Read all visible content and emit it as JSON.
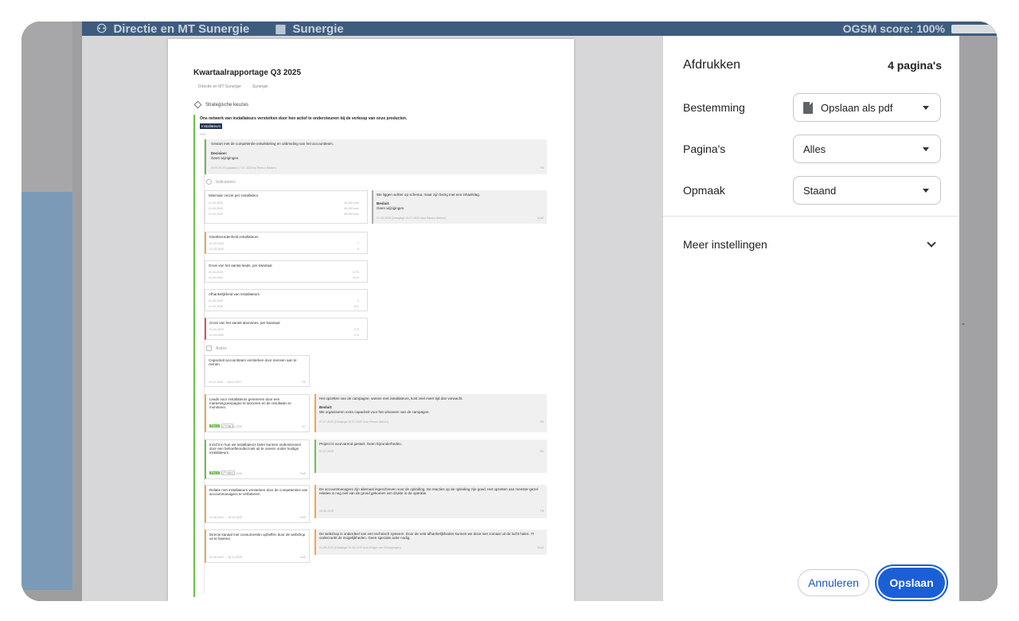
{
  "app": {
    "breadcrumb_team": "Directie en MT Sunergie",
    "breadcrumb_org": "Sunergie",
    "score": "OGSM score: 100%"
  },
  "print_panel": {
    "title": "Afdrukken",
    "page_count": "4 pagina's",
    "destination_label": "Bestemming",
    "destination_value": "Opslaan als pdf",
    "pages_label": "Pagina's",
    "pages_value": "Alles",
    "layout_label": "Opmaak",
    "layout_value": "Staand",
    "more_settings": "Meer instellingen",
    "cancel": "Annuleren",
    "save": "Opslaan"
  },
  "report": {
    "title": "Kwartaalrapportage Q3 2025",
    "crumb_team": "Directie en MT Sunergie",
    "crumb_org": "Sunergie",
    "section": "Strategische keuzes",
    "goal": "Ons netwerk van installateurs versterken door hen actief te ondersteunen bij de verkoop van onze producten.",
    "goal_tag": "Installateurs",
    "goal_owner": "RvS",
    "update_text": "Gestart met de competentie-ontwikkeling en uitbreiding van het accountteam.",
    "update_decision_label": "Decision:",
    "update_decision": "Geen wijzigingen.",
    "update_meta": "2025-09-29 (Updated 17-07-2025 by Remco Bakker)",
    "update_initials": "FB",
    "indicators_header": "Indicatoren",
    "indicators": [
      {
        "name": "Minimale omzet per installateur",
        "rows": [
          [
            "01-03-2025",
            "30.000 euro"
          ],
          [
            "01-03-2026",
            "60.000 euro"
          ],
          [
            "01-03-2030",
            "60.000 euro"
          ]
        ]
      },
      {
        "name": "Klanttevredenheid installateurs",
        "rows": [
          [
            "01-03-2025",
            "7"
          ],
          [
            "01-03-2030",
            "8"
          ]
        ]
      },
      {
        "name": "Groei van het aantal leads, per kwartaal",
        "rows": [
          [
            "01-03-2025",
            "12 %"
          ],
          [
            "01-03-2030",
            "15 %"
          ]
        ]
      },
      {
        "name": "Afhankelijkheid van installateurs",
        "rows": [
          [
            "01-03-2025",
            "9"
          ],
          [
            "01-03-2030",
            "10,2"
          ]
        ]
      },
      {
        "name": "Groei van het aantal abonnees, per kwartaal",
        "rows": [
          [
            "01-03-2025",
            "5 %"
          ],
          [
            "01-03-2030",
            "5 %"
          ]
        ]
      }
    ],
    "indicator_note": {
      "text": "We liggen achter op schema, maar zijn bezig met een inhaalslag.",
      "decision_label": "Besluit:",
      "decision": "Geen wijzigingen.",
      "meta": "01-03-2025 (Gewijzigd 10-07-2025 door Remco Bakker)",
      "initials": "AvdZ"
    },
    "actions_header": "Acties",
    "actions": [
      {
        "name": "Capaciteit accountteam versterken door mensen aan te nemen.",
        "meta": "15-10-2025 → 15-02-2027",
        "initials": "FK"
      },
      {
        "name": "Leads voor installateurs genereren door een marketingcampagne te lanceren en de resultaten te monitoren.",
        "meta": "15-12-2024 → 26-08-2025",
        "initials": "SC",
        "badge": "Prio 1",
        "tag": "Hoog"
      },
      {
        "name": "Inzicht in hoe we installateurs beter kunnen ondersteunen door een behoefteonderzoek uit te voeren onder huidige installateurs.",
        "meta": "01-03-2025 → 15-12-2025",
        "initials": "RvS",
        "badge": "Prio 1",
        "tag": "Project"
      },
      {
        "name": "Relatie met installateurs versterken door de competenties van accountmanagers te verbeteren.",
        "meta": "01-06-2024 → 28-10-2025",
        "initials": "RvS"
      },
      {
        "name": "Directe kanaal met consumenten opheffen door de webshop uit te faseren.",
        "meta": "01-06-2024 → 28-11-2025",
        "initials": "RvS"
      }
    ],
    "action_notes": [
      {
        "text": "Het opzetten van de campagne, samen met installateurs, kost veel meer tijd dan verwacht.",
        "decision_label": "Besluit:",
        "decision": "We organiseren extra capaciteit voor het uitvoeren van de campagne.",
        "meta": "27-07-2025 (Gewijzigd 10-07-2025 door Remco Bakker)",
        "initials": "FB"
      },
      {
        "text": "Project is voorvarend gestart. Geen bijzonderheden.",
        "meta": "01-07-2025",
        "initials": "RB"
      },
      {
        "text": "De accountmanagers zijn allemaal ingeschreven voor de opleiding. De reacties op de opleiding zijn goed. Het opzetten van meester-gezel relaties is nog niet van de grond gekomen ivm drukte in de operatie.",
        "meta": "26-08-2025",
        "initials": "FB"
      },
      {
        "text": "De webshop is onderdeel van een technisch systeem. Door de vele afhankelijkheden kunnen we deze niet zomaar uit de lucht halen. IT onderzoekt de mogelijkheden. Geen speciale actie nodig.",
        "meta": "01-08-2025 (Gewijzigd 10-06-2025 door Rutger van Scheppingen)",
        "initials": "AvdZ"
      }
    ]
  },
  "colors": {
    "accent": "#1a5fd6",
    "goal_green": "#6cc04a",
    "indicator_orange": "#f3a64a",
    "indicator_red": "#e05050"
  }
}
